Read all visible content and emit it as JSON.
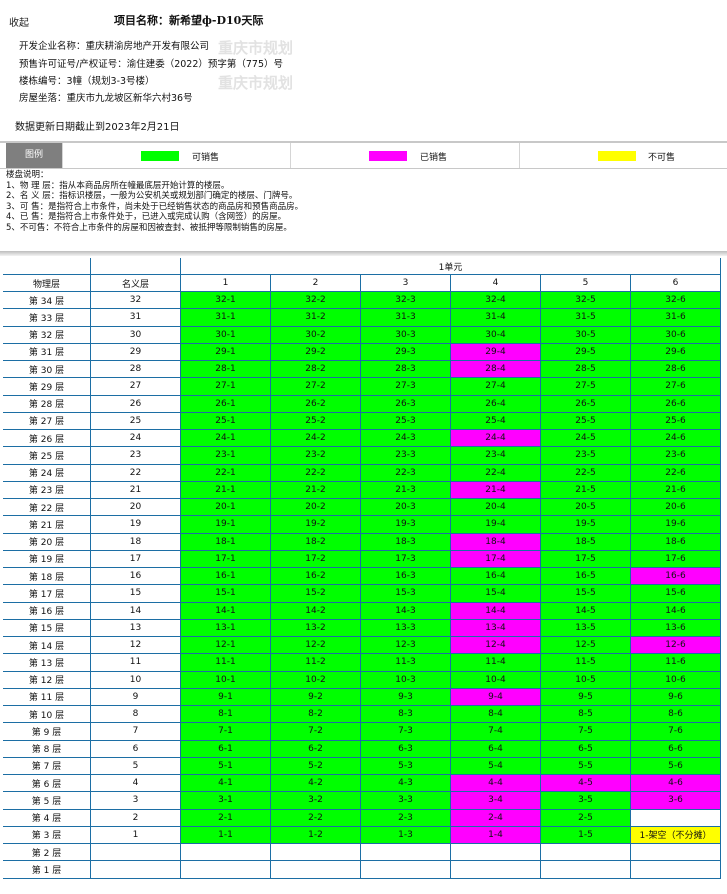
{
  "header": {
    "collapse_label": "收起",
    "project_label": "项目名称：",
    "project_name": "新希望ф-D10天际",
    "developer": "开发企业名称：重庆耕渝房地产开发有限公司",
    "permit": "预售许可证号/产权证号：渝住建委（2022）预字第（775）号",
    "building_no": "楼栋编号：3幢（规划3-3号楼）",
    "address": "房屋坐落：重庆市九龙坡区新华六村36号",
    "watermark_1": "重庆市规划",
    "watermark_2": "重庆市规划",
    "update_note": "数据更新日期截止到2023年2月21日"
  },
  "legend": {
    "title": "图例",
    "items": [
      {
        "label": "可销售",
        "color": "#00ff00"
      },
      {
        "label": "已销售",
        "color": "#ff00ff"
      },
      {
        "label": "不可售",
        "color": "#ffff00"
      }
    ]
  },
  "notes": [
    "楼盘说明：",
    "1、物 理 层：指从本商品房所在幢最底层开始计算的楼层。",
    "2、名 义 层：指标识楼层，一般为公安机关或规划部门确定的楼层、门牌号。",
    "3、可 售：是指符合上市条件，尚未处于已经销售状态的商品房和预售商品房。",
    "4、已 售：是指符合上市条件处于，已进入或完成认购（含网签）的房屋。",
    "5、不可售：不符合上市条件的房屋和因被查封、被抵押等限制销售的房屋。"
  ],
  "table": {
    "unit_label": "1单元",
    "col_physical": "物理层",
    "col_nominal": "名义层",
    "rooms": [
      "1",
      "2",
      "3",
      "4",
      "5",
      "6"
    ],
    "colors": {
      "available": "#00ff00",
      "sold": "#ff00ff",
      "unsellable": "#ffff00"
    },
    "rows": [
      {
        "phys": "第 34 层",
        "nom": "32",
        "cells": [
          [
            "32-1",
            "a"
          ],
          [
            "32-2",
            "a"
          ],
          [
            "32-3",
            "a"
          ],
          [
            "32-4",
            "a"
          ],
          [
            "32-5",
            "a"
          ],
          [
            "32-6",
            "a"
          ]
        ]
      },
      {
        "phys": "第 33 层",
        "nom": "31",
        "cells": [
          [
            "31-1",
            "a"
          ],
          [
            "31-2",
            "a"
          ],
          [
            "31-3",
            "a"
          ],
          [
            "31-4",
            "a"
          ],
          [
            "31-5",
            "a"
          ],
          [
            "31-6",
            "a"
          ]
        ]
      },
      {
        "phys": "第 32 层",
        "nom": "30",
        "cells": [
          [
            "30-1",
            "a"
          ],
          [
            "30-2",
            "a"
          ],
          [
            "30-3",
            "a"
          ],
          [
            "30-4",
            "a"
          ],
          [
            "30-5",
            "a"
          ],
          [
            "30-6",
            "a"
          ]
        ]
      },
      {
        "phys": "第 31 层",
        "nom": "29",
        "cells": [
          [
            "29-1",
            "a"
          ],
          [
            "29-2",
            "a"
          ],
          [
            "29-3",
            "a"
          ],
          [
            "29-4",
            "s"
          ],
          [
            "29-5",
            "a"
          ],
          [
            "29-6",
            "a"
          ]
        ]
      },
      {
        "phys": "第 30 层",
        "nom": "28",
        "cells": [
          [
            "28-1",
            "a"
          ],
          [
            "28-2",
            "a"
          ],
          [
            "28-3",
            "a"
          ],
          [
            "28-4",
            "s"
          ],
          [
            "28-5",
            "a"
          ],
          [
            "28-6",
            "a"
          ]
        ]
      },
      {
        "phys": "第 29 层",
        "nom": "27",
        "cells": [
          [
            "27-1",
            "a"
          ],
          [
            "27-2",
            "a"
          ],
          [
            "27-3",
            "a"
          ],
          [
            "27-4",
            "a"
          ],
          [
            "27-5",
            "a"
          ],
          [
            "27-6",
            "a"
          ]
        ]
      },
      {
        "phys": "第 28 层",
        "nom": "26",
        "cells": [
          [
            "26-1",
            "a"
          ],
          [
            "26-2",
            "a"
          ],
          [
            "26-3",
            "a"
          ],
          [
            "26-4",
            "a"
          ],
          [
            "26-5",
            "a"
          ],
          [
            "26-6",
            "a"
          ]
        ]
      },
      {
        "phys": "第 27 层",
        "nom": "25",
        "cells": [
          [
            "25-1",
            "a"
          ],
          [
            "25-2",
            "a"
          ],
          [
            "25-3",
            "a"
          ],
          [
            "25-4",
            "a"
          ],
          [
            "25-5",
            "a"
          ],
          [
            "25-6",
            "a"
          ]
        ]
      },
      {
        "phys": "第 26 层",
        "nom": "24",
        "cells": [
          [
            "24-1",
            "a"
          ],
          [
            "24-2",
            "a"
          ],
          [
            "24-3",
            "a"
          ],
          [
            "24-4",
            "s"
          ],
          [
            "24-5",
            "a"
          ],
          [
            "24-6",
            "a"
          ]
        ]
      },
      {
        "phys": "第 25 层",
        "nom": "23",
        "cells": [
          [
            "23-1",
            "a"
          ],
          [
            "23-2",
            "a"
          ],
          [
            "23-3",
            "a"
          ],
          [
            "23-4",
            "a"
          ],
          [
            "23-5",
            "a"
          ],
          [
            "23-6",
            "a"
          ]
        ]
      },
      {
        "phys": "第 24 层",
        "nom": "22",
        "cells": [
          [
            "22-1",
            "a"
          ],
          [
            "22-2",
            "a"
          ],
          [
            "22-3",
            "a"
          ],
          [
            "22-4",
            "a"
          ],
          [
            "22-5",
            "a"
          ],
          [
            "22-6",
            "a"
          ]
        ]
      },
      {
        "phys": "第 23 层",
        "nom": "21",
        "cells": [
          [
            "21-1",
            "a"
          ],
          [
            "21-2",
            "a"
          ],
          [
            "21-3",
            "a"
          ],
          [
            "21-4",
            "s"
          ],
          [
            "21-5",
            "a"
          ],
          [
            "21-6",
            "a"
          ]
        ]
      },
      {
        "phys": "第 22 层",
        "nom": "20",
        "cells": [
          [
            "20-1",
            "a"
          ],
          [
            "20-2",
            "a"
          ],
          [
            "20-3",
            "a"
          ],
          [
            "20-4",
            "a"
          ],
          [
            "20-5",
            "a"
          ],
          [
            "20-6",
            "a"
          ]
        ]
      },
      {
        "phys": "第 21 层",
        "nom": "19",
        "cells": [
          [
            "19-1",
            "a"
          ],
          [
            "19-2",
            "a"
          ],
          [
            "19-3",
            "a"
          ],
          [
            "19-4",
            "a"
          ],
          [
            "19-5",
            "a"
          ],
          [
            "19-6",
            "a"
          ]
        ]
      },
      {
        "phys": "第 20 层",
        "nom": "18",
        "cells": [
          [
            "18-1",
            "a"
          ],
          [
            "18-2",
            "a"
          ],
          [
            "18-3",
            "a"
          ],
          [
            "18-4",
            "s"
          ],
          [
            "18-5",
            "a"
          ],
          [
            "18-6",
            "a"
          ]
        ]
      },
      {
        "phys": "第 19 层",
        "nom": "17",
        "cells": [
          [
            "17-1",
            "a"
          ],
          [
            "17-2",
            "a"
          ],
          [
            "17-3",
            "a"
          ],
          [
            "17-4",
            "s"
          ],
          [
            "17-5",
            "a"
          ],
          [
            "17-6",
            "a"
          ]
        ]
      },
      {
        "phys": "第 18 层",
        "nom": "16",
        "cells": [
          [
            "16-1",
            "a"
          ],
          [
            "16-2",
            "a"
          ],
          [
            "16-3",
            "a"
          ],
          [
            "16-4",
            "a"
          ],
          [
            "16-5",
            "a"
          ],
          [
            "16-6",
            "s"
          ]
        ]
      },
      {
        "phys": "第 17 层",
        "nom": "15",
        "cells": [
          [
            "15-1",
            "a"
          ],
          [
            "15-2",
            "a"
          ],
          [
            "15-3",
            "a"
          ],
          [
            "15-4",
            "a"
          ],
          [
            "15-5",
            "a"
          ],
          [
            "15-6",
            "a"
          ]
        ]
      },
      {
        "phys": "第 16 层",
        "nom": "14",
        "cells": [
          [
            "14-1",
            "a"
          ],
          [
            "14-2",
            "a"
          ],
          [
            "14-3",
            "a"
          ],
          [
            "14-4",
            "s"
          ],
          [
            "14-5",
            "a"
          ],
          [
            "14-6",
            "a"
          ]
        ]
      },
      {
        "phys": "第 15 层",
        "nom": "13",
        "cells": [
          [
            "13-1",
            "a"
          ],
          [
            "13-2",
            "a"
          ],
          [
            "13-3",
            "a"
          ],
          [
            "13-4",
            "s"
          ],
          [
            "13-5",
            "a"
          ],
          [
            "13-6",
            "a"
          ]
        ]
      },
      {
        "phys": "第 14 层",
        "nom": "12",
        "cells": [
          [
            "12-1",
            "a"
          ],
          [
            "12-2",
            "a"
          ],
          [
            "12-3",
            "a"
          ],
          [
            "12-4",
            "s"
          ],
          [
            "12-5",
            "a"
          ],
          [
            "12-6",
            "s"
          ]
        ]
      },
      {
        "phys": "第 13 层",
        "nom": "11",
        "cells": [
          [
            "11-1",
            "a"
          ],
          [
            "11-2",
            "a"
          ],
          [
            "11-3",
            "a"
          ],
          [
            "11-4",
            "a"
          ],
          [
            "11-5",
            "a"
          ],
          [
            "11-6",
            "a"
          ]
        ]
      },
      {
        "phys": "第 12 层",
        "nom": "10",
        "cells": [
          [
            "10-1",
            "a"
          ],
          [
            "10-2",
            "a"
          ],
          [
            "10-3",
            "a"
          ],
          [
            "10-4",
            "a"
          ],
          [
            "10-5",
            "a"
          ],
          [
            "10-6",
            "a"
          ]
        ]
      },
      {
        "phys": "第 11 层",
        "nom": "9",
        "cells": [
          [
            "9-1",
            "a"
          ],
          [
            "9-2",
            "a"
          ],
          [
            "9-3",
            "a"
          ],
          [
            "9-4",
            "s"
          ],
          [
            "9-5",
            "a"
          ],
          [
            "9-6",
            "a"
          ]
        ]
      },
      {
        "phys": "第 10 层",
        "nom": "8",
        "cells": [
          [
            "8-1",
            "a"
          ],
          [
            "8-2",
            "a"
          ],
          [
            "8-3",
            "a"
          ],
          [
            "8-4",
            "a"
          ],
          [
            "8-5",
            "a"
          ],
          [
            "8-6",
            "a"
          ]
        ]
      },
      {
        "phys": "第 9 层",
        "nom": "7",
        "cells": [
          [
            "7-1",
            "a"
          ],
          [
            "7-2",
            "a"
          ],
          [
            "7-3",
            "a"
          ],
          [
            "7-4",
            "a"
          ],
          [
            "7-5",
            "a"
          ],
          [
            "7-6",
            "a"
          ]
        ]
      },
      {
        "phys": "第 8 层",
        "nom": "6",
        "cells": [
          [
            "6-1",
            "a"
          ],
          [
            "6-2",
            "a"
          ],
          [
            "6-3",
            "a"
          ],
          [
            "6-4",
            "a"
          ],
          [
            "6-5",
            "a"
          ],
          [
            "6-6",
            "a"
          ]
        ]
      },
      {
        "phys": "第 7 层",
        "nom": "5",
        "cells": [
          [
            "5-1",
            "a"
          ],
          [
            "5-2",
            "a"
          ],
          [
            "5-3",
            "a"
          ],
          [
            "5-4",
            "a"
          ],
          [
            "5-5",
            "a"
          ],
          [
            "5-6",
            "a"
          ]
        ]
      },
      {
        "phys": "第 6 层",
        "nom": "4",
        "cells": [
          [
            "4-1",
            "a"
          ],
          [
            "4-2",
            "a"
          ],
          [
            "4-3",
            "a"
          ],
          [
            "4-4",
            "s"
          ],
          [
            "4-5",
            "s"
          ],
          [
            "4-6",
            "s"
          ]
        ]
      },
      {
        "phys": "第 5 层",
        "nom": "3",
        "cells": [
          [
            "3-1",
            "a"
          ],
          [
            "3-2",
            "a"
          ],
          [
            "3-3",
            "a"
          ],
          [
            "3-4",
            "s"
          ],
          [
            "3-5",
            "a"
          ],
          [
            "3-6",
            "s"
          ]
        ]
      },
      {
        "phys": "第 4 层",
        "nom": "2",
        "cells": [
          [
            "2-1",
            "a"
          ],
          [
            "2-2",
            "a"
          ],
          [
            "2-3",
            "a"
          ],
          [
            "2-4",
            "s"
          ],
          [
            "2-5",
            "a"
          ],
          [
            "",
            "w"
          ]
        ]
      },
      {
        "phys": "第 3 层",
        "nom": "1",
        "cells": [
          [
            "1-1",
            "a"
          ],
          [
            "1-2",
            "a"
          ],
          [
            "1-3",
            "a"
          ],
          [
            "1-4",
            "s"
          ],
          [
            "1-5",
            "a"
          ],
          [
            "1-架空（不分摊）",
            "u"
          ]
        ]
      },
      {
        "phys": "第 2 层",
        "nom": "",
        "cells": [
          [
            "",
            "w"
          ],
          [
            "",
            "w"
          ],
          [
            "",
            "w"
          ],
          [
            "",
            "w"
          ],
          [
            "",
            "w"
          ],
          [
            "",
            "w"
          ]
        ]
      },
      {
        "phys": "第 1 层",
        "nom": "",
        "cells": [
          [
            "",
            "w"
          ],
          [
            "",
            "w"
          ],
          [
            "",
            "w"
          ],
          [
            "",
            "w"
          ],
          [
            "",
            "w"
          ],
          [
            "",
            "w"
          ]
        ]
      }
    ]
  }
}
